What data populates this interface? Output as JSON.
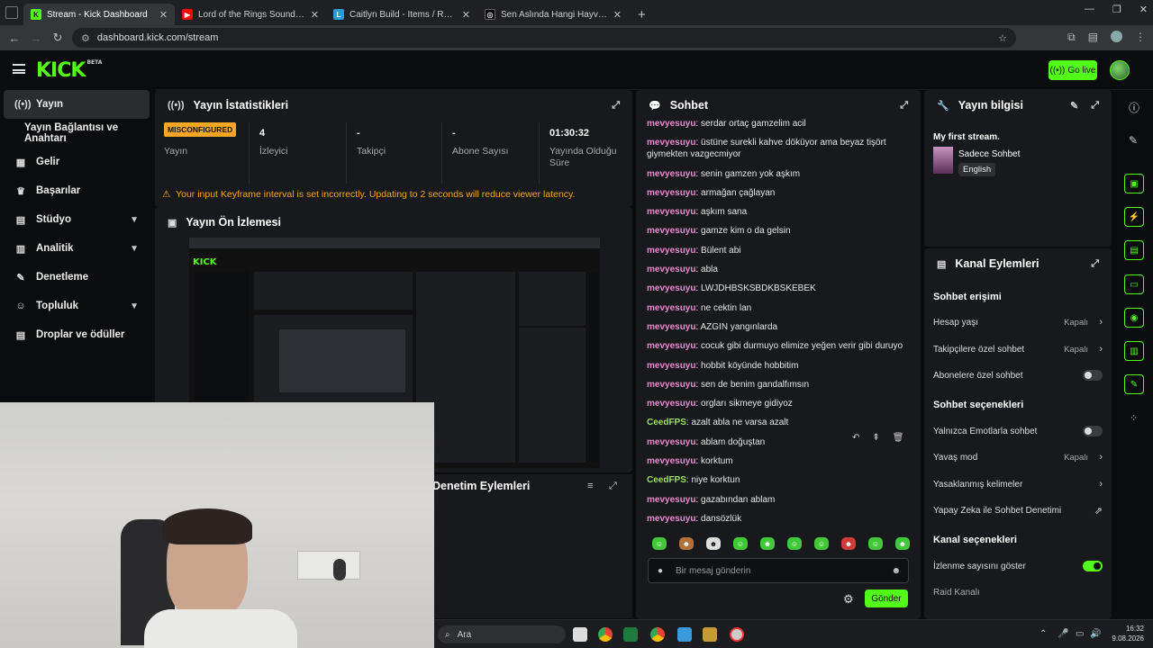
{
  "browser": {
    "tabs": [
      {
        "title": "Stream - Kick Dashboard",
        "icon": "K",
        "color": "#53fc18",
        "active": true
      },
      {
        "title": "Lord of the Rings Sound of The",
        "icon": "▶",
        "color": "#ff0000",
        "active": false
      },
      {
        "title": "Caitlyn Build - Items / Runes / I",
        "icon": "L",
        "color": "#2b9bd6",
        "active": false
      },
      {
        "title": "Sen Aslında Hangi Hayvanın Ru",
        "icon": "◎",
        "color": "#111111",
        "active": false
      }
    ],
    "url": "dashboard.kick.com/stream"
  },
  "topbar": {
    "logo": "KICK",
    "logo_badge": "BETA",
    "go_live_label": "Go live"
  },
  "sidebar": {
    "items": [
      {
        "label": "Yayın",
        "icon": "((•))",
        "name": "yayin",
        "active": true
      },
      {
        "label": "Yayın Bağlantısı ve Anahtarı",
        "icon": "",
        "name": "yayin-baglantisi",
        "sub": true
      },
      {
        "label": "Gelir",
        "icon": "▦",
        "name": "gelir"
      },
      {
        "label": "Başarılar",
        "icon": "🏆",
        "name": "basarilar"
      },
      {
        "label": "Stüdyo",
        "icon": "▤",
        "name": "studyo",
        "chevron": true
      },
      {
        "label": "Analitik",
        "icon": "▥",
        "name": "analitik",
        "chevron": true
      },
      {
        "label": "Denetleme",
        "icon": "✎",
        "name": "denetleme"
      },
      {
        "label": "Topluluk",
        "icon": "👥",
        "name": "topluluk",
        "chevron": true
      },
      {
        "label": "Droplar ve ödüller",
        "icon": "▤",
        "name": "droplar"
      }
    ]
  },
  "stats": {
    "title": "Yayın İstatistikleri",
    "status_badge": "MISCONFIGURED",
    "status_label": "Yayın",
    "viewers_value": "4",
    "viewers_label": "İzleyici",
    "followers_value": "-",
    "followers_label": "Takipçi",
    "subs_value": "-",
    "subs_label": "Abone Sayısı",
    "uptime_value": "01:30:32",
    "uptime_label": "Yayında Olduğu Süre",
    "warning": "Your input Keyframe interval is set incorrectly. Updating to 2 seconds will reduce viewer latency."
  },
  "preview": {
    "title": "Yayın Ön İzlemesi"
  },
  "moderation": {
    "title": "Denetim Eylemleri"
  },
  "chat": {
    "title": "Sohbet",
    "messages": [
      {
        "user": "mevyesuyu",
        "text": "serdar ortaç gamzelim acil",
        "color": "#e88bd0"
      },
      {
        "user": "mevyesuyu",
        "text": "üstüne surekli kahve döküyor ama beyaz tişört giymekten vazgecmiyor",
        "color": "#e88bd0"
      },
      {
        "user": "mevyesuyu",
        "text": "senin gamzen yok aşkım",
        "color": "#e88bd0"
      },
      {
        "user": "mevyesuyu",
        "text": "armağan çağlayan",
        "color": "#e88bd0"
      },
      {
        "user": "mevyesuyu",
        "text": "aşkım sana",
        "color": "#e88bd0"
      },
      {
        "user": "mevyesuyu",
        "text": "gamze kim o da gelsin",
        "color": "#e88bd0"
      },
      {
        "user": "mevyesuyu",
        "text": "Bülent abi",
        "color": "#e88bd0"
      },
      {
        "user": "mevyesuyu",
        "text": "abla",
        "color": "#e88bd0"
      },
      {
        "user": "mevyesuyu",
        "text": "LWJDHBSKSBDKBSKEBEK",
        "color": "#e88bd0"
      },
      {
        "user": "mevyesuyu",
        "text": "ne cektin lan",
        "color": "#e88bd0"
      },
      {
        "user": "mevyesuyu",
        "text": "AZGIN yangınlarda",
        "color": "#e88bd0"
      },
      {
        "user": "mevyesuyu",
        "text": "cocuk gibi durmuyo elimize yeğen verir gibi duruyo",
        "color": "#e88bd0"
      },
      {
        "user": "mevyesuyu",
        "text": "hobbit köyünde hobbitim",
        "color": "#e88bd0"
      },
      {
        "user": "mevyesuyu",
        "text": "sen de benim gandalfımsın",
        "color": "#e88bd0"
      },
      {
        "user": "mevyesuyu",
        "text": "orgları sikmeye gidiyoz",
        "color": "#e88bd0"
      },
      {
        "user": "CeedFPS",
        "text": "azalt abla ne varsa azalt",
        "color": "#9be35a"
      },
      {
        "user": "mevyesuyu",
        "text": "ablam doğuştan",
        "color": "#e88bd0"
      },
      {
        "user": "mevyesuyu",
        "text": "korktum",
        "color": "#e88bd0"
      },
      {
        "user": "CeedFPS",
        "text": "niye korktun",
        "color": "#9be35a"
      },
      {
        "user": "mevyesuyu",
        "text": "gazabından ablam",
        "color": "#e88bd0"
      },
      {
        "user": "mevyesuyu",
        "text": "dansözlük",
        "color": "#e88bd0"
      }
    ],
    "input_placeholder": "Bir mesaj gönderin",
    "send_label": "Gönder"
  },
  "stream_info": {
    "title": "Yayın bilgisi",
    "stream_title": "My first stream.",
    "category": "Sadece Sohbet",
    "language": "English"
  },
  "channel_actions": {
    "title": "Kanal Eylemleri",
    "chat_access_title": "Sohbet erişimi",
    "account_age_label": "Hesap yaşı",
    "account_age_value": "Kapalı",
    "followers_only_label": "Takipçilere özel sohbet",
    "followers_only_value": "Kapalı",
    "subs_only_label": "Abonelere özel sohbet",
    "chat_options_title": "Sohbet seçenekleri",
    "emote_only_label": "Yalnızca Emotlarla sohbet",
    "slow_mode_label": "Yavaş mod",
    "slow_mode_value": "Kapalı",
    "banned_words_label": "Yasaklanmış kelimeler",
    "ai_moderation_label": "Yapay Zeka ile Sohbet Denetimi",
    "channel_options_title": "Kanal seçenekleri",
    "show_viewcount_label": "İzlenme sayısını göster",
    "raid_label": "Raid Kanalı"
  },
  "taskbar": {
    "search_label": "Ara",
    "time": "16:32",
    "date": "9.08.2026"
  },
  "colors": {
    "accent": "#53fc18",
    "warning": "#f5a623",
    "panel": "#18191c",
    "background": "#0b0c0d"
  }
}
